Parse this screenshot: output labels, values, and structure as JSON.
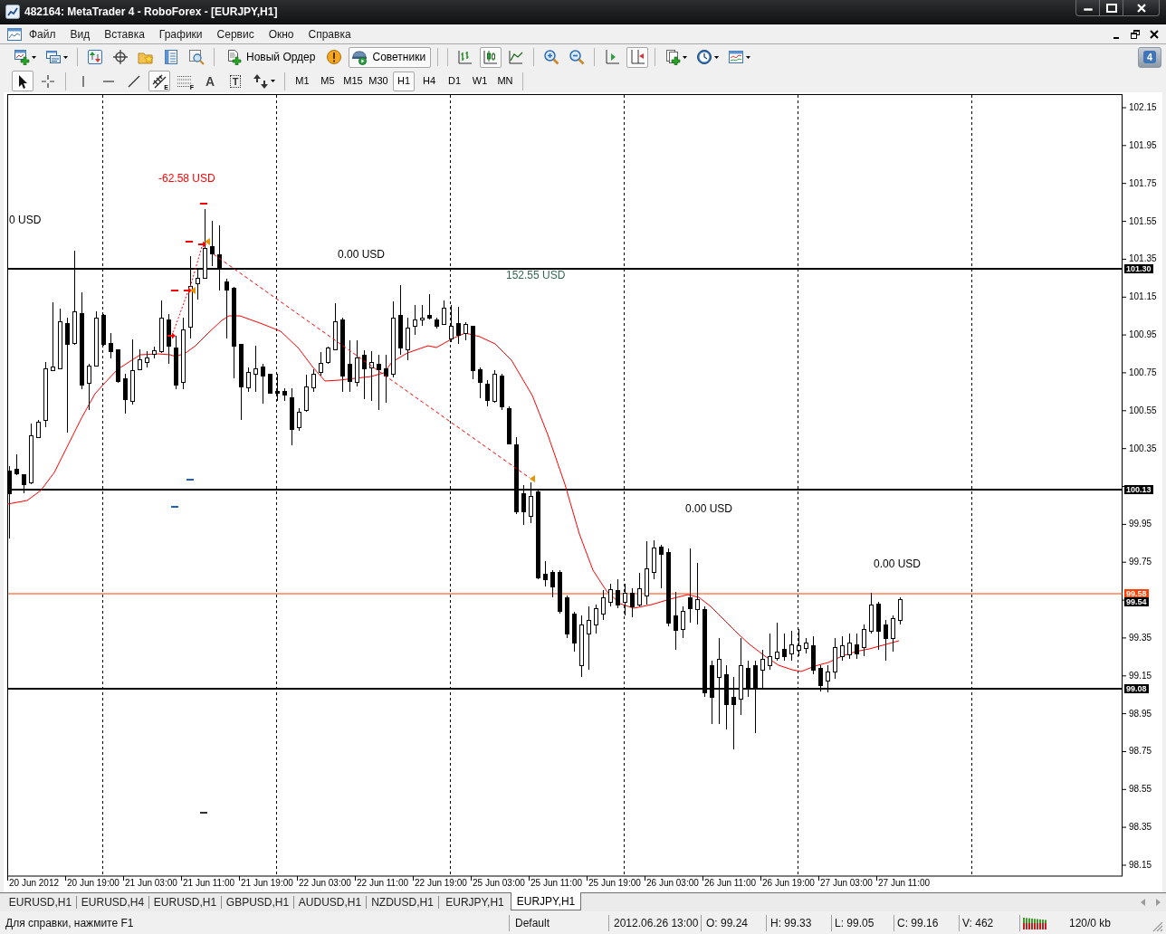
{
  "window": {
    "title": "482164: MetaTrader 4 - RoboForex - [EURJPY,H1]"
  },
  "menu": [
    "Файл",
    "Вид",
    "Вставка",
    "Графики",
    "Сервис",
    "Окно",
    "Справка"
  ],
  "toolbar": {
    "new_order": "Новый Ордер",
    "experts": {
      "label": "Советники",
      "selected": true
    },
    "chart_types": [
      {
        "kind": "bars",
        "selected": false
      },
      {
        "kind": "candles",
        "selected": true
      },
      {
        "kind": "line",
        "selected": false
      }
    ],
    "chart_options": [
      {
        "kind": "autoscroll",
        "selected": false
      },
      {
        "kind": "shift",
        "selected": true
      }
    ],
    "messages": "4"
  },
  "drawing_tools": [
    {
      "kind": "cursor",
      "selected": true
    },
    {
      "kind": "crosshair",
      "selected": false
    },
    {
      "kind": "vline",
      "selected": false
    },
    {
      "kind": "hline",
      "selected": false
    },
    {
      "kind": "trendline",
      "selected": false
    },
    {
      "kind": "channel",
      "selected": true,
      "glyph": "E"
    },
    {
      "kind": "fibo",
      "selected": false,
      "glyph": "F"
    },
    {
      "kind": "text",
      "selected": false,
      "glyph": "A"
    },
    {
      "kind": "label",
      "selected": false,
      "glyph": "T"
    },
    {
      "kind": "arrows",
      "selected": false
    }
  ],
  "timeframes": [
    {
      "label": "M1",
      "selected": false
    },
    {
      "label": "M5",
      "selected": false
    },
    {
      "label": "M15",
      "selected": false
    },
    {
      "label": "M30",
      "selected": false
    },
    {
      "label": "H1",
      "selected": true
    },
    {
      "label": "H4",
      "selected": false
    },
    {
      "label": "D1",
      "selected": false
    },
    {
      "label": "W1",
      "selected": false
    },
    {
      "label": "MN",
      "selected": false
    }
  ],
  "chart": {
    "profit_labels": [
      {
        "text": "-62.58 USD",
        "color": "#ff0000"
      },
      {
        "text": "0 USD",
        "color": "#000000"
      },
      {
        "text": "0.00 USD",
        "color": "#000000"
      },
      {
        "text": "152.55 USD",
        "color": "#336655"
      },
      {
        "text": "0.00 USD",
        "color": "#000000"
      },
      {
        "text": "0.00 USD",
        "color": "#000000"
      }
    ],
    "levels": [
      {
        "kind": "line",
        "tag": "101.30",
        "color": "#000000"
      },
      {
        "kind": "line",
        "tag": "100.13",
        "color": "#000000"
      },
      {
        "kind": "thin_line",
        "tag": "99.58",
        "color": "#ff4000"
      },
      {
        "kind": "tag",
        "tag": "99.54",
        "color": "#000000"
      },
      {
        "kind": "line",
        "tag": "99.08",
        "color": "#000000"
      }
    ],
    "price_axis": [
      "102.15",
      "101.95",
      "101.75",
      "101.55",
      "101.35",
      "101.15",
      "100.95",
      "100.75",
      "100.55",
      "100.35",
      "99.95",
      "99.75",
      "99.35",
      "99.15",
      "98.95",
      "98.75",
      "98.55",
      "98.35",
      "98.15"
    ],
    "time_axis": [
      "20 Jun 2012",
      "20 Jun 19:00",
      "21 Jun 03:00",
      "21 Jun 11:00",
      "21 Jun 19:00",
      "22 Jun 03:00",
      "22 Jun 11:00",
      "22 Jun 19:00",
      "25 Jun 03:00",
      "25 Jun 11:00",
      "25 Jun 19:00",
      "26 Jun 03:00",
      "26 Jun 11:00",
      "26 Jun 19:00",
      "27 Jun 03:00",
      "27 Jun 11:00"
    ]
  },
  "tabs": [
    {
      "label": "EURUSD,H1",
      "selected": false
    },
    {
      "label": "EURUSD,H4",
      "selected": false
    },
    {
      "label": "EURUSD,H1",
      "selected": false
    },
    {
      "label": "GBPUSD,H1",
      "selected": false
    },
    {
      "label": "AUDUSD,H1",
      "selected": false
    },
    {
      "label": "NZDUSD,H1",
      "selected": false
    },
    {
      "label": "EURJPY,H1",
      "selected": false
    },
    {
      "label": "EURJPY,H1",
      "selected": true
    }
  ],
  "status_bar": {
    "help": "Для справки, нажмите F1",
    "profile": "Default",
    "time": "2012.06.26 13:00",
    "open": "O: 99.24",
    "high": "H: 99.33",
    "low": "L: 99.05",
    "close": "C: 99.16",
    "volume": "V: 462",
    "traffic": "120/0 kb"
  }
}
